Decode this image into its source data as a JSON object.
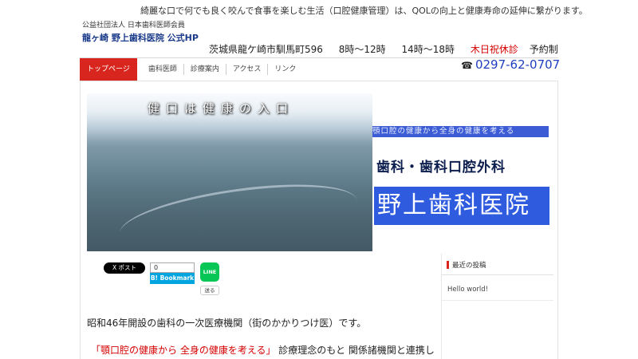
{
  "header": {
    "tagline": "綺麗な口で何でも良く咬んで食事を楽しむ生活（口腔健康管理）は、QOLの向上と健康寿命の延伸に繋がります。",
    "association": "公益社団法人 日本歯科医師会員",
    "clinic_hp": "龍ヶ崎 野上歯科医院 公式HP",
    "address": "茨城県龍ケ崎市馴馬町596",
    "hours_morning": "8時～12時",
    "hours_afternoon": "14時～18時",
    "closed_days": "木日祝休診",
    "reservation": "予約制",
    "phone": "0297-62-0707"
  },
  "nav": {
    "items": [
      "トップページ",
      "歯科医師",
      "診療案内",
      "アクセス",
      "リンク"
    ]
  },
  "hero": {
    "title": "健口は健康の入口",
    "sub_banner": "顎口腔の健康から全身の健康を考える",
    "department": "歯科・歯科口腔外科",
    "clinic_name": "野上歯科医院"
  },
  "social": {
    "post_label": "X ポスト",
    "hatena_count": "0",
    "hatena_label": "B! Bookmark",
    "line_label": "LINE",
    "line_send": "送る"
  },
  "sidebar": {
    "heading": "最近の投稿",
    "post": "Hello world!"
  },
  "content": {
    "intro": "昭和46年開設の歯科の一次医療機関（街のかかりつけ医）です。",
    "motto": "「顎口腔の健康から 全身の健康を考える」",
    "motto_tail": " 診療理念のもと 関係諸機関と連携し"
  },
  "colors": {
    "nav_active": "#d8251e",
    "phone": "#1f3fbf",
    "banner_blue": "#2f5bdf",
    "closed_red": "#d40000"
  }
}
